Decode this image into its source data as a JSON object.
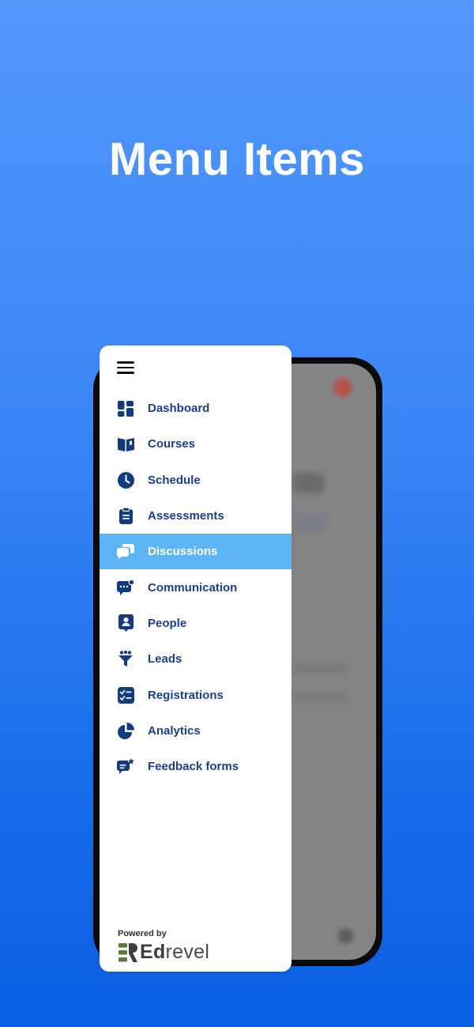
{
  "headline": "Menu Items",
  "colors": {
    "accent_active": "#5eb5f6",
    "menu_text": "#1d3f8a",
    "icon": "#143a80",
    "brand_green": "#5d7a3a"
  },
  "drawer": {
    "menu_icon": "hamburger-icon",
    "items": [
      {
        "label": "Dashboard",
        "icon": "grid-icon",
        "active": false
      },
      {
        "label": "Courses",
        "icon": "book-icon",
        "active": false
      },
      {
        "label": "Schedule",
        "icon": "clock-icon",
        "active": false
      },
      {
        "label": "Assessments",
        "icon": "clipboard-icon",
        "active": false
      },
      {
        "label": "Discussions",
        "icon": "chat-bubbles-icon",
        "active": true
      },
      {
        "label": "Communication",
        "icon": "message-dots-icon",
        "active": false
      },
      {
        "label": "People",
        "icon": "person-badge-icon",
        "active": false
      },
      {
        "label": "Leads",
        "icon": "funnel-icon",
        "active": false
      },
      {
        "label": "Registrations",
        "icon": "checklist-icon",
        "active": false
      },
      {
        "label": "Analytics",
        "icon": "pie-chart-icon",
        "active": false
      },
      {
        "label": "Feedback forms",
        "icon": "feedback-icon",
        "active": false
      }
    ],
    "footer": {
      "powered_by": "Powered by",
      "brand_mark": "Edrevel"
    }
  }
}
